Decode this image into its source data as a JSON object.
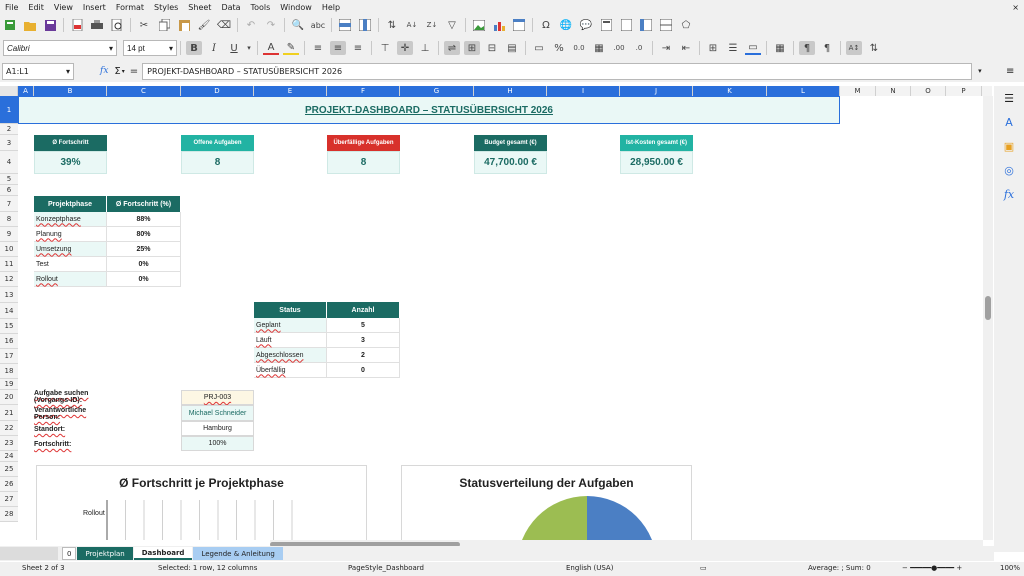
{
  "menubar": {
    "items": [
      "File",
      "Edit",
      "View",
      "Insert",
      "Format",
      "Styles",
      "Sheet",
      "Data",
      "Tools",
      "Window",
      "Help"
    ],
    "close": "×"
  },
  "toolbar": {
    "font_name": "Calibri",
    "font_size": "14 pt",
    "percent": "%",
    "decimal": "0.0",
    "decimal2": ".00"
  },
  "formula_bar": {
    "name_box": "A1:L1",
    "fx": "fx",
    "sigma": "Σ",
    "equals": "=",
    "content": "PROJEKT-DASHBOARD – STATUSÜBERSICHT 2026"
  },
  "columns": [
    "A",
    "B",
    "C",
    "D",
    "E",
    "F",
    "G",
    "H",
    "I",
    "J",
    "K",
    "L",
    "M",
    "N",
    "O",
    "P"
  ],
  "rows": [
    "1",
    "2",
    "3",
    "4",
    "5",
    "6",
    "7",
    "8",
    "9",
    "10",
    "11",
    "12",
    "13",
    "14",
    "15",
    "16",
    "17",
    "18",
    "19",
    "20",
    "21",
    "22",
    "23",
    "24",
    "25",
    "26",
    "27",
    "28"
  ],
  "sheet": {
    "title": "PROJEKT-DASHBOARD – STATUSÜBERSICHT 2026",
    "kpis": [
      {
        "label": "Ø Fortschritt",
        "value": "39%",
        "color": "#1b6b63"
      },
      {
        "label": "Offene Aufgaben",
        "value": "8",
        "color": "#22b3a3"
      },
      {
        "label": "Überfällige Aufgaben",
        "value": "8",
        "color": "#d8312b"
      },
      {
        "label": "Budget gesamt (€)",
        "value": "47,700.00 €",
        "color": "#1b6b63"
      },
      {
        "label": "Ist-Kosten gesamt (€)",
        "value": "28,950.00 €",
        "color": "#22b3a3"
      }
    ],
    "phase_table": {
      "headers": [
        "Projektphase",
        "Ø Fortschritt (%)"
      ],
      "rows": [
        {
          "phase": "Konzeptphase",
          "value": "88%"
        },
        {
          "phase": "Planung",
          "value": "80%"
        },
        {
          "phase": "Umsetzung",
          "value": "25%"
        },
        {
          "phase": "Test",
          "value": "0%"
        },
        {
          "phase": "Rollout",
          "value": "0%"
        }
      ]
    },
    "status_table": {
      "headers": [
        "Status",
        "Anzahl"
      ],
      "rows": [
        {
          "status": "Geplant",
          "count": "5"
        },
        {
          "status": "Läuft",
          "count": "3"
        },
        {
          "status": "Abgeschlossen",
          "count": "2"
        },
        {
          "status": "Überfällig",
          "count": "0"
        }
      ]
    },
    "lookup": {
      "search_label": "Aufgabe suchen (Vorgangs-ID):",
      "search_value": "PRJ-003",
      "person_label": "Verantwortliche Person:",
      "person_value": "Michael Schneider",
      "location_label": "Standort:",
      "location_value": "Hamburg",
      "progress_label": "Fortschritt:",
      "progress_value": "100%"
    },
    "chart_left_title": "Ø Fortschritt je Projektphase",
    "chart_right_title": "Statusverteilung der Aufgaben"
  },
  "chart_data": [
    {
      "type": "bar",
      "title": "Ø Fortschritt je Projektphase",
      "categories": [
        "Rollout"
      ],
      "values": []
    },
    {
      "type": "pie",
      "title": "Statusverteilung der Aufgaben",
      "categories": [],
      "values": [],
      "colors": [
        "#9cbd52",
        "#4b7fc4"
      ]
    }
  ],
  "sheet_tabs": {
    "tabs": [
      "Projektplan",
      "Dashboard",
      "Legende & Anleitung"
    ],
    "index_label": "0"
  },
  "statusbar": {
    "sheet": "Sheet 2 of 3",
    "selection": "Selected: 1 row, 12 columns",
    "pagestyle": "PageStyle_Dashboard",
    "language": "English (USA)",
    "sum": "Average: ; Sum: 0",
    "zoom": "100%"
  }
}
